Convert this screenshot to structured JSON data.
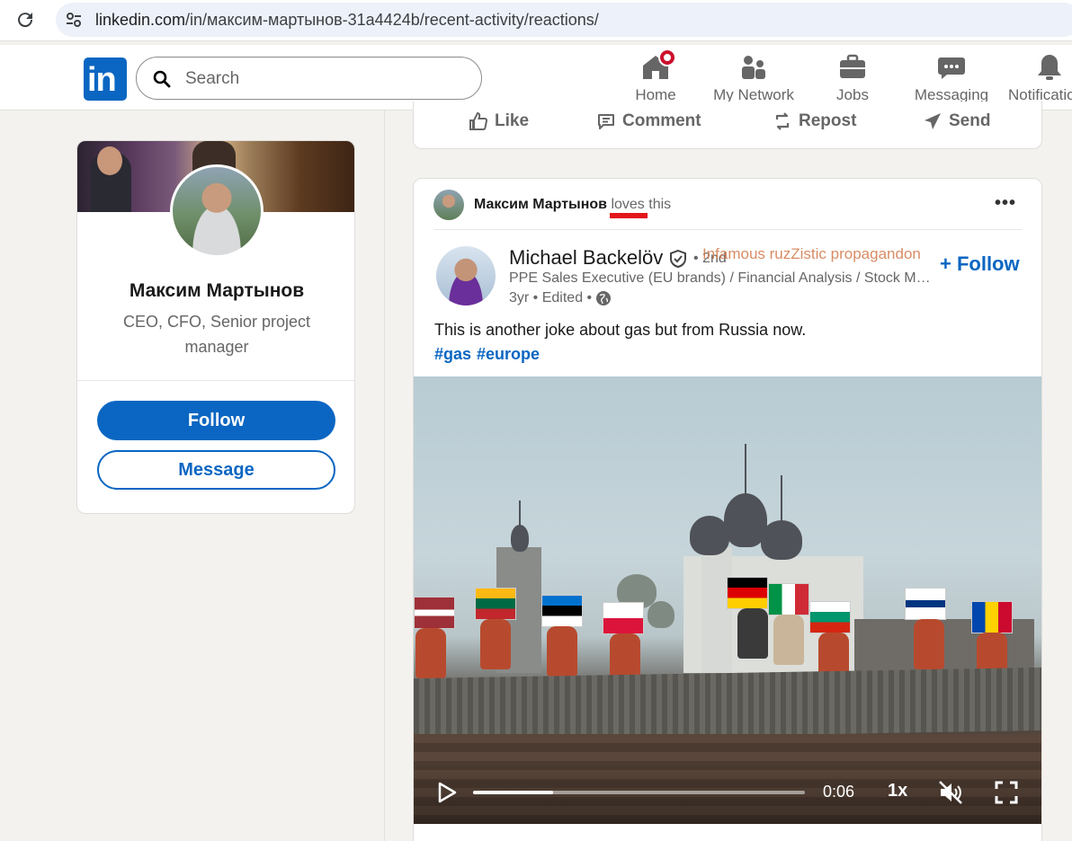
{
  "browser": {
    "url_domain": "linkedin.com",
    "url_path": "/in/максим-мартынов-31a4424b/recent-activity/reactions/"
  },
  "nav": {
    "search_placeholder": "Search",
    "items": [
      {
        "label": "Home",
        "icon": "home-icon"
      },
      {
        "label": "My Network",
        "icon": "network-icon"
      },
      {
        "label": "Jobs",
        "icon": "briefcase-icon"
      },
      {
        "label": "Messaging",
        "icon": "messaging-icon"
      },
      {
        "label": "Notifications",
        "icon": "bell-icon"
      }
    ]
  },
  "profile": {
    "name": "Максим Мартынов",
    "headline": "CEO, CFO, Senior project manager",
    "follow_label": "Follow",
    "message_label": "Message"
  },
  "prev_post_actions": {
    "like": "Like",
    "comment": "Comment",
    "repost": "Repost",
    "send": "Send"
  },
  "post": {
    "activity_actor": "Максим Мартынов",
    "activity_verb": "loves",
    "activity_suffix": "this",
    "author_name": "Michael Backelöv",
    "degree": "• 2nd",
    "overlay_annotation": "Infamous ruzZistic propagandon",
    "author_subtitle": "PPE Sales Executive (EU brands) / Financial Analysis / Stock Ma...",
    "author_meta": "3yr • Edited •",
    "follow_label": "+ Follow",
    "text": "This is another joke about gas but from Russia now.",
    "hashtags": [
      "#gas",
      "#europe"
    ],
    "video": {
      "time": "0:06",
      "speed": "1x",
      "progress": 0.24
    }
  },
  "colors": {
    "linkedin_blue": "#0a66c2",
    "badge_red": "#cb112d",
    "annotation_red": "#e3161c",
    "page_bg": "#f4f2ee"
  }
}
